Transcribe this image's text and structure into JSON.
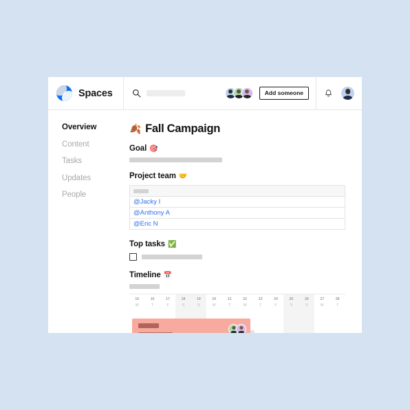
{
  "app": {
    "brand_name": "Spaces",
    "logo_color": "#1570ef"
  },
  "header": {
    "search_placeholder": "",
    "add_someone_label": "Add someone",
    "search_icon": "search-icon",
    "bell_icon": "bell-icon",
    "member_avatars": [
      "member-avatar-1",
      "member-avatar-2",
      "member-avatar-3"
    ],
    "current_user_avatar": "current-user-avatar"
  },
  "sidebar": {
    "items": [
      {
        "label": "Overview",
        "active": true
      },
      {
        "label": "Content",
        "active": false
      },
      {
        "label": "Tasks",
        "active": false
      },
      {
        "label": "Updates",
        "active": false
      },
      {
        "label": "People",
        "active": false
      }
    ]
  },
  "page": {
    "title": "Fall Campaign",
    "title_emoji": "🍂",
    "sections": {
      "goal": {
        "heading": "Goal",
        "emoji": "🎯"
      },
      "team": {
        "heading": "Project team",
        "emoji": "🤝",
        "members": [
          "@Jacky I",
          "@Anthony A",
          "@Eric N"
        ]
      },
      "tasks": {
        "heading": "Top tasks",
        "emoji": "✅"
      },
      "timeline": {
        "heading": "Timeline",
        "emoji": "📅"
      }
    }
  },
  "calendar": {
    "days": [
      {
        "num": "15",
        "dow": "W",
        "weekend": false
      },
      {
        "num": "16",
        "dow": "T",
        "weekend": false
      },
      {
        "num": "17",
        "dow": "F",
        "weekend": false
      },
      {
        "num": "18",
        "dow": "S",
        "weekend": true
      },
      {
        "num": "19",
        "dow": "S",
        "weekend": true
      },
      {
        "num": "20",
        "dow": "M",
        "weekend": false
      },
      {
        "num": "21",
        "dow": "T",
        "weekend": false
      },
      {
        "num": "22",
        "dow": "W",
        "weekend": false
      },
      {
        "num": "23",
        "dow": "T",
        "weekend": false
      },
      {
        "num": "24",
        "dow": "F",
        "weekend": false
      },
      {
        "num": "25",
        "dow": "S",
        "weekend": true
      },
      {
        "num": "26",
        "dow": "S",
        "weekend": true
      },
      {
        "num": "27",
        "dow": "M",
        "weekend": false
      },
      {
        "num": "28",
        "dow": "T",
        "weekend": false
      }
    ],
    "event": {
      "color": "#f8aa9e",
      "avatars": [
        "event-avatar-1",
        "event-avatar-2"
      ]
    }
  }
}
